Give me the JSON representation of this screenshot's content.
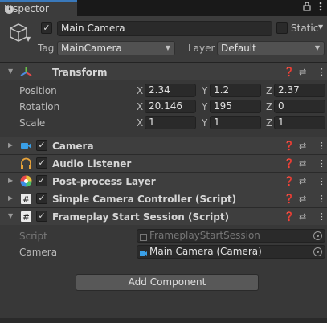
{
  "tab": {
    "title": "Inspector",
    "info_icon": "info-icon",
    "lock_icon": "lock-icon",
    "menu_icon": "kebab-menu-icon"
  },
  "gameobject": {
    "name": "Main Camera",
    "active": true,
    "static_label": "Static",
    "static_checked": false,
    "tag_label": "Tag",
    "tag_value": "MainCamera",
    "layer_label": "Layer",
    "layer_value": "Default"
  },
  "transform": {
    "title": "Transform",
    "rows": [
      {
        "label": "Position",
        "x": "2.34",
        "y": "1.2",
        "z": "2.37"
      },
      {
        "label": "Rotation",
        "x": "20.146",
        "y": "195",
        "z": "0"
      },
      {
        "label": "Scale",
        "x": "1",
        "y": "1",
        "z": "1"
      }
    ],
    "axis": {
      "x": "X",
      "y": "Y",
      "z": "Z"
    }
  },
  "components": [
    {
      "title": "Camera",
      "icon": "camera-icon",
      "enabled": true,
      "collapsed": true
    },
    {
      "title": "Audio Listener",
      "icon": "headphones-icon",
      "enabled": true,
      "collapsed": true
    },
    {
      "title": "Post-process Layer",
      "icon": "post-process-icon",
      "enabled": true,
      "collapsed": true
    },
    {
      "title": "Simple Camera Controller (Script)",
      "icon": "script-icon",
      "enabled": true,
      "collapsed": true
    },
    {
      "title": "Frameplay Start Session (Script)",
      "icon": "script-icon",
      "enabled": true,
      "collapsed": false
    }
  ],
  "frameplay": {
    "script_label": "Script",
    "script_value": "FrameplayStartSession",
    "camera_label": "Camera",
    "camera_value": "Main Camera (Camera)"
  },
  "add_component_label": "Add Component",
  "colors": {
    "accent": "#3a79bb",
    "panel": "#383838",
    "header": "#3e3e3e",
    "field": "#2a2a2a"
  }
}
